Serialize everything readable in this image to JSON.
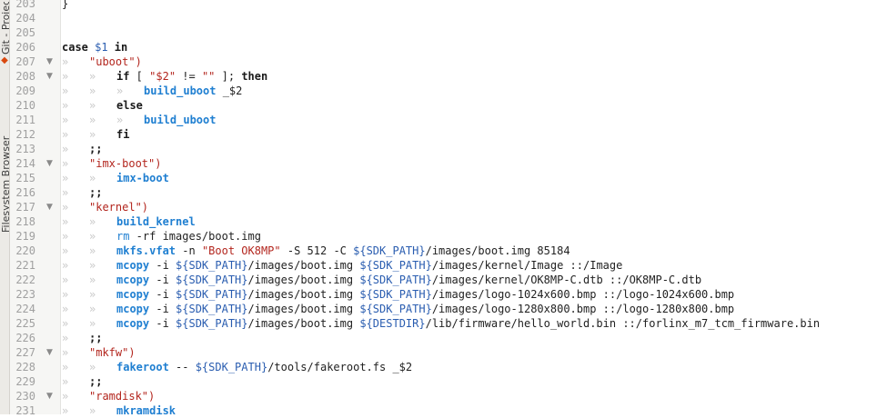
{
  "sidebar": {
    "tabs": [
      {
        "label": "Filesystem Browser",
        "icon": "folder-icon"
      },
      {
        "label": "Git - Project",
        "icon": "diamond-icon"
      }
    ]
  },
  "fold_markers": {
    "open": "▼",
    "tab": "»"
  },
  "lines": [
    {
      "n": "203",
      "fold": "",
      "indent": 0,
      "parts": [
        {
          "t": "}",
          "c": "plain"
        }
      ]
    },
    {
      "n": "204",
      "fold": "",
      "indent": 0,
      "parts": []
    },
    {
      "n": "205",
      "fold": "",
      "indent": 0,
      "parts": []
    },
    {
      "n": "206",
      "fold": "",
      "indent": 0,
      "parts": [
        {
          "t": "case ",
          "c": "kw"
        },
        {
          "t": "$1",
          "c": "var"
        },
        {
          "t": " in",
          "c": "kw"
        }
      ]
    },
    {
      "n": "207",
      "fold": "open",
      "indent": 1,
      "parts": [
        {
          "t": "\"uboot\")",
          "c": "str"
        }
      ]
    },
    {
      "n": "208",
      "fold": "open",
      "indent": 2,
      "parts": [
        {
          "t": "if",
          "c": "kw"
        },
        {
          "t": " [ ",
          "c": "plain"
        },
        {
          "t": "\"$2\"",
          "c": "str"
        },
        {
          "t": " != ",
          "c": "plain"
        },
        {
          "t": "\"\"",
          "c": "str"
        },
        {
          "t": " ]; ",
          "c": "plain"
        },
        {
          "t": "then",
          "c": "kw"
        }
      ]
    },
    {
      "n": "209",
      "fold": "",
      "indent": 3,
      "parts": [
        {
          "t": "build_uboot",
          "c": "fn"
        },
        {
          "t": " _$2",
          "c": "plain"
        }
      ]
    },
    {
      "n": "210",
      "fold": "",
      "indent": 2,
      "parts": [
        {
          "t": "else",
          "c": "kw"
        }
      ]
    },
    {
      "n": "211",
      "fold": "",
      "indent": 3,
      "parts": [
        {
          "t": "build_uboot",
          "c": "fn"
        }
      ]
    },
    {
      "n": "212",
      "fold": "",
      "indent": 2,
      "parts": [
        {
          "t": "fi",
          "c": "kw"
        }
      ]
    },
    {
      "n": "213",
      "fold": "",
      "indent": 1,
      "parts": [
        {
          "t": ";;",
          "c": "kw"
        }
      ]
    },
    {
      "n": "214",
      "fold": "open",
      "indent": 1,
      "parts": [
        {
          "t": "\"imx-boot\")",
          "c": "str"
        }
      ]
    },
    {
      "n": "215",
      "fold": "",
      "indent": 2,
      "parts": [
        {
          "t": "imx-boot",
          "c": "fn"
        }
      ]
    },
    {
      "n": "216",
      "fold": "",
      "indent": 1,
      "parts": [
        {
          "t": ";;",
          "c": "kw"
        }
      ]
    },
    {
      "n": "217",
      "fold": "open",
      "indent": 1,
      "parts": [
        {
          "t": "\"kernel\")",
          "c": "str"
        }
      ]
    },
    {
      "n": "218",
      "fold": "",
      "indent": 2,
      "parts": [
        {
          "t": "build_kernel",
          "c": "fn"
        }
      ]
    },
    {
      "n": "219",
      "fold": "",
      "indent": 2,
      "parts": [
        {
          "t": "rm",
          "c": "cmd"
        },
        {
          "t": " -rf images/boot.img",
          "c": "plain"
        }
      ]
    },
    {
      "n": "220",
      "fold": "",
      "indent": 2,
      "parts": [
        {
          "t": "mkfs.vfat",
          "c": "fn"
        },
        {
          "t": " -n ",
          "c": "plain"
        },
        {
          "t": "\"Boot OK8MP\"",
          "c": "str"
        },
        {
          "t": " -S 512 -C ",
          "c": "plain"
        },
        {
          "t": "${SDK_PATH}",
          "c": "var"
        },
        {
          "t": "/images/boot.img 85184",
          "c": "plain"
        }
      ]
    },
    {
      "n": "221",
      "fold": "",
      "indent": 2,
      "parts": [
        {
          "t": "mcopy",
          "c": "fn"
        },
        {
          "t": " -i ",
          "c": "plain"
        },
        {
          "t": "${SDK_PATH}",
          "c": "var"
        },
        {
          "t": "/images/boot.img ",
          "c": "plain"
        },
        {
          "t": "${SDK_PATH}",
          "c": "var"
        },
        {
          "t": "/images/kernel/Image ::/Image",
          "c": "plain"
        }
      ]
    },
    {
      "n": "222",
      "fold": "",
      "indent": 2,
      "parts": [
        {
          "t": "mcopy",
          "c": "fn"
        },
        {
          "t": " -i ",
          "c": "plain"
        },
        {
          "t": "${SDK_PATH}",
          "c": "var"
        },
        {
          "t": "/images/boot.img ",
          "c": "plain"
        },
        {
          "t": "${SDK_PATH}",
          "c": "var"
        },
        {
          "t": "/images/kernel/OK8MP-C.dtb ::/OK8MP-C.dtb",
          "c": "plain"
        }
      ]
    },
    {
      "n": "223",
      "fold": "",
      "indent": 2,
      "parts": [
        {
          "t": "mcopy",
          "c": "fn"
        },
        {
          "t": " -i ",
          "c": "plain"
        },
        {
          "t": "${SDK_PATH}",
          "c": "var"
        },
        {
          "t": "/images/boot.img ",
          "c": "plain"
        },
        {
          "t": "${SDK_PATH}",
          "c": "var"
        },
        {
          "t": "/images/logo-1024x600.bmp ::/logo-1024x600.bmp",
          "c": "plain"
        }
      ]
    },
    {
      "n": "224",
      "fold": "",
      "indent": 2,
      "parts": [
        {
          "t": "mcopy",
          "c": "fn"
        },
        {
          "t": " -i ",
          "c": "plain"
        },
        {
          "t": "${SDK_PATH}",
          "c": "var"
        },
        {
          "t": "/images/boot.img ",
          "c": "plain"
        },
        {
          "t": "${SDK_PATH}",
          "c": "var"
        },
        {
          "t": "/images/logo-1280x800.bmp ::/logo-1280x800.bmp",
          "c": "plain"
        }
      ]
    },
    {
      "n": "225",
      "fold": "",
      "indent": 2,
      "parts": [
        {
          "t": "mcopy",
          "c": "fn"
        },
        {
          "t": " -i ",
          "c": "plain"
        },
        {
          "t": "${SDK_PATH}",
          "c": "var"
        },
        {
          "t": "/images/boot.img ",
          "c": "plain"
        },
        {
          "t": "${DESTDIR}",
          "c": "var"
        },
        {
          "t": "/lib/firmware/hello_world.bin ::/forlinx_m7_tcm_firmware.bin",
          "c": "plain"
        }
      ]
    },
    {
      "n": "226",
      "fold": "",
      "indent": 1,
      "parts": [
        {
          "t": ";;",
          "c": "kw"
        }
      ]
    },
    {
      "n": "227",
      "fold": "open",
      "indent": 1,
      "parts": [
        {
          "t": "\"mkfw\")",
          "c": "str"
        }
      ]
    },
    {
      "n": "228",
      "fold": "",
      "indent": 2,
      "parts": [
        {
          "t": "fakeroot",
          "c": "fn"
        },
        {
          "t": " -- ",
          "c": "plain"
        },
        {
          "t": "${SDK_PATH}",
          "c": "var"
        },
        {
          "t": "/tools/fakeroot.fs _$2",
          "c": "plain"
        }
      ]
    },
    {
      "n": "229",
      "fold": "",
      "indent": 1,
      "parts": [
        {
          "t": ";;",
          "c": "kw"
        }
      ]
    },
    {
      "n": "230",
      "fold": "open",
      "indent": 1,
      "parts": [
        {
          "t": "\"ramdisk\")",
          "c": "str"
        }
      ]
    },
    {
      "n": "231",
      "fold": "",
      "indent": 2,
      "parts": [
        {
          "t": "mkramdisk",
          "c": "fn"
        }
      ]
    }
  ]
}
